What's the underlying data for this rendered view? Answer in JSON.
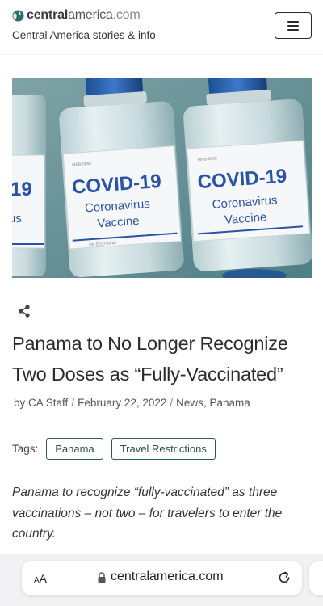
{
  "header": {
    "logo_name": "central",
    "logo_name2": "america",
    "logo_tld": ".com",
    "tagline": "Central America stories & info",
    "menu_icon": "hamburger-icon"
  },
  "hero": {
    "label_main": "COVID-19",
    "label_sub1": "Coronavirus",
    "label_sub2": "Vaccine",
    "partial_left_main": "19",
    "partial_left_sub": "us"
  },
  "article": {
    "share_icon": "share-icon",
    "title": "Panama to No Longer Recognize Two Doses as “Fully-Vaccinated”",
    "meta": {
      "prefix": "by",
      "author": "CA Staff",
      "date": "February 22, 2022",
      "category1": "News",
      "category2": "Panama"
    },
    "tags_label": "Tags:",
    "tags": [
      "Panama",
      "Travel Restrictions"
    ],
    "excerpt": "Panama to recognize “fully-vaccinated” as three vaccinations – not two – for travelers to enter the country."
  },
  "browser": {
    "text_size_label": "AA",
    "url": "centralamerica.com",
    "lock_icon": "lock-icon",
    "reload_icon": "reload-icon"
  },
  "colors": {
    "tag_border": "#2e5c56",
    "logo_globe_teal": "#2e6e68"
  }
}
